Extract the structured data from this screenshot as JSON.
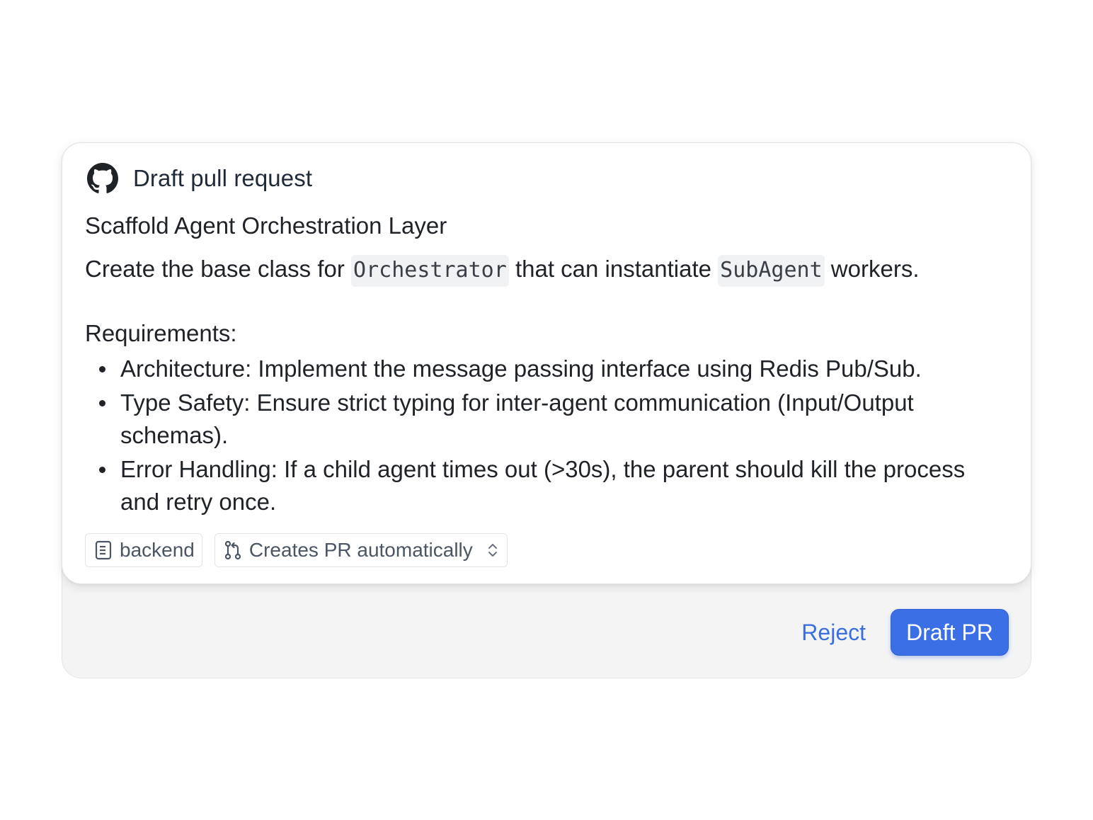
{
  "header": {
    "icon": "github-icon",
    "title": "Draft pull request"
  },
  "pr": {
    "title": "Scaffold Agent Orchestration Layer",
    "description": {
      "part1": "Create the base class for ",
      "code1": "Orchestrator",
      "part2": " that can instantiate ",
      "code2": "SubAgent",
      "part3": " workers."
    },
    "requirements_heading": "Requirements:",
    "requirements": [
      "Architecture: Implement the message passing interface using Redis Pub/Sub.",
      "Type Safety: Ensure strict typing for inter-agent communication (Input/Output schemas).",
      "Error Handling: If a child agent times out (>30s), the parent should kill the process and retry once."
    ]
  },
  "chips": {
    "repo": {
      "icon": "repo-icon",
      "label": "backend"
    },
    "mode": {
      "icon": "pull-request-icon",
      "label": "Creates PR automatically",
      "trailing_icon": "chevron-up-down-icon"
    }
  },
  "actions": {
    "reject_label": "Reject",
    "draft_label": "Draft PR"
  },
  "colors": {
    "accent": "#3b6fe6",
    "link": "#3b6fe0",
    "footer_bg": "#f4f4f5"
  }
}
